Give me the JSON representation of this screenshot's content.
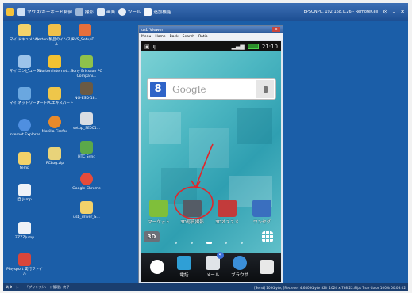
{
  "topbar": {
    "keyboard_mouse_label": "マウス/キーボード制御",
    "shoot_label": "撮影",
    "screen_label": "画面",
    "tools_label": "ツール",
    "extra_label": "追加機能",
    "remote_title": "EPSONPC, 192.168.0.26 - RemoteCell"
  },
  "desktop": {
    "icons": [
      {
        "label": "マイ ドキュメント",
        "color": "#f3d36a"
      },
      {
        "label": "Norton 製品のインストール",
        "color": "#f2c14a"
      },
      {
        "label": "RVS_SetupD...",
        "color": "#e46f3c"
      },
      {
        "label": "マイ コンピュータ",
        "color": "#9cc3ea"
      },
      {
        "label": "Norton Internet...",
        "color": "#f2c232"
      },
      {
        "label": "Sony Ericsson PC Compani...",
        "color": "#8fc24a"
      },
      {
        "label": "マイ ネットワーク",
        "color": "#6aa7e0"
      },
      {
        "label": "ノートPCエキスパート",
        "color": "#eec64a"
      },
      {
        "label": "NG-ESD-18...",
        "color": "#6a5a44"
      },
      {
        "label": "Internet Explorer",
        "color": "#4f8fe0"
      },
      {
        "label": "Mozilla Firefox",
        "color": "#e88a2c"
      },
      {
        "label": "setup_SE001...",
        "color": "#d9dde3"
      },
      {
        "label": "temp",
        "color": "#f2d26a"
      },
      {
        "label": "PCLog.zip",
        "color": "#e8d37a"
      },
      {
        "label": "HTC Sync",
        "color": "#5ba84a"
      },
      {
        "label": "Google Chrome",
        "color": "#e54b3b"
      },
      {
        "label": "自 Jump",
        "color": "#eef2f7"
      },
      {
        "label": "usb_driver_S...",
        "color": "#f2d26a"
      },
      {
        "label": "ZZZZJump",
        "color": "#eef2f7"
      },
      {
        "label": "Playsport 実行ファイル",
        "color": "#d9463b"
      }
    ]
  },
  "viewer": {
    "window_title": "usb Viewer",
    "menu_items": [
      "Menu",
      "Home",
      "Back",
      "Search",
      "Ratio"
    ],
    "close_label": "x"
  },
  "phone": {
    "clock": "21:10",
    "search_placeholder": "Google",
    "google_letter": "8",
    "apps": [
      {
        "label": "マーケット",
        "color": "#7fbf3a"
      },
      {
        "label": "3D写真撮影",
        "color": "#555c66"
      },
      {
        "label": "3Dオススメ",
        "color": "#c23b3b"
      },
      {
        "label": "ワンセグ",
        "color": "#3a6fbf"
      }
    ],
    "widget_3d_label": "3D",
    "dock": [
      {
        "label": "",
        "color": "#ffffff"
      },
      {
        "label": "電話",
        "color": "#2f9fd6"
      },
      {
        "label": "メール",
        "color": "#e0e4e8"
      },
      {
        "label": "ブラウザ",
        "color": "#3b8fd9"
      },
      {
        "label": "",
        "color": "#e8e8e8"
      }
    ],
    "mail_badge": "4"
  },
  "taskbar": {
    "start_label": "スタート",
    "task_label": "「プリンタ/ハード管理」終了",
    "stats": "[Send] 10 Kbyte, [Recieve] 4,640 Kbyte  82fr  1024 x 768 22.8fps  True Color  100%  00:08:02"
  },
  "colors": {
    "desktop_bg": "#1b5ea8",
    "annotation_red": "#e0262b"
  }
}
